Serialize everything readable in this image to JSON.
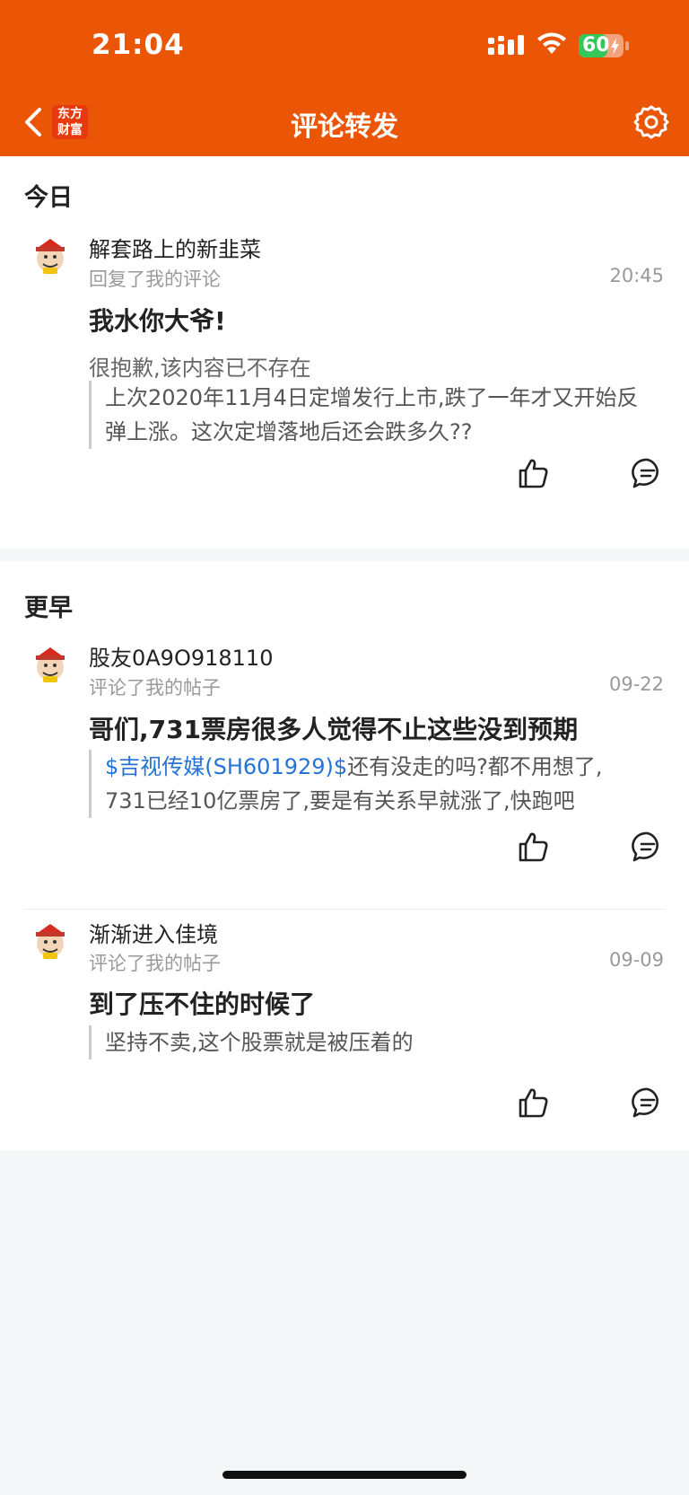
{
  "status_bar": {
    "time": "21:04",
    "battery": "60"
  },
  "header": {
    "title": "评论转发",
    "logo_line1": "东方",
    "logo_line2": "财富"
  },
  "sections": [
    {
      "title": "今日",
      "items": [
        {
          "username": "解套路上的新韭菜",
          "action": "回复了我的评论",
          "time": "20:45",
          "comment": "我水你大爷!",
          "deleted_notice": "很抱歉,该内容已不存在",
          "quote_line1": "上次2020年11月4日定增发行上市,跌了一年才又开始反",
          "quote_line2": "弹上涨。这次定增落地后还会跌多久??"
        }
      ]
    },
    {
      "title": "更早",
      "items": [
        {
          "username": "股友0A9O918110",
          "action": "评论了我的帖子",
          "time": "09-22",
          "comment": "哥们,731票房很多人觉得不止这些没到预期",
          "quote_link": "$吉视传媒(SH601929)$",
          "quote_line1_rest": "还有没走的吗?都不用想了,",
          "quote_line2": "731已经10亿票房了,要是有关系早就涨了,快跑吧"
        },
        {
          "username": "渐渐进入佳境",
          "action": "评论了我的帖子",
          "time": "09-09",
          "comment": "到了压不住的时候了",
          "quote_line1": "坚持不卖,这个股票就是被压着的"
        }
      ]
    }
  ],
  "colors": {
    "brand": "#ea5506",
    "link": "#2673d6"
  }
}
